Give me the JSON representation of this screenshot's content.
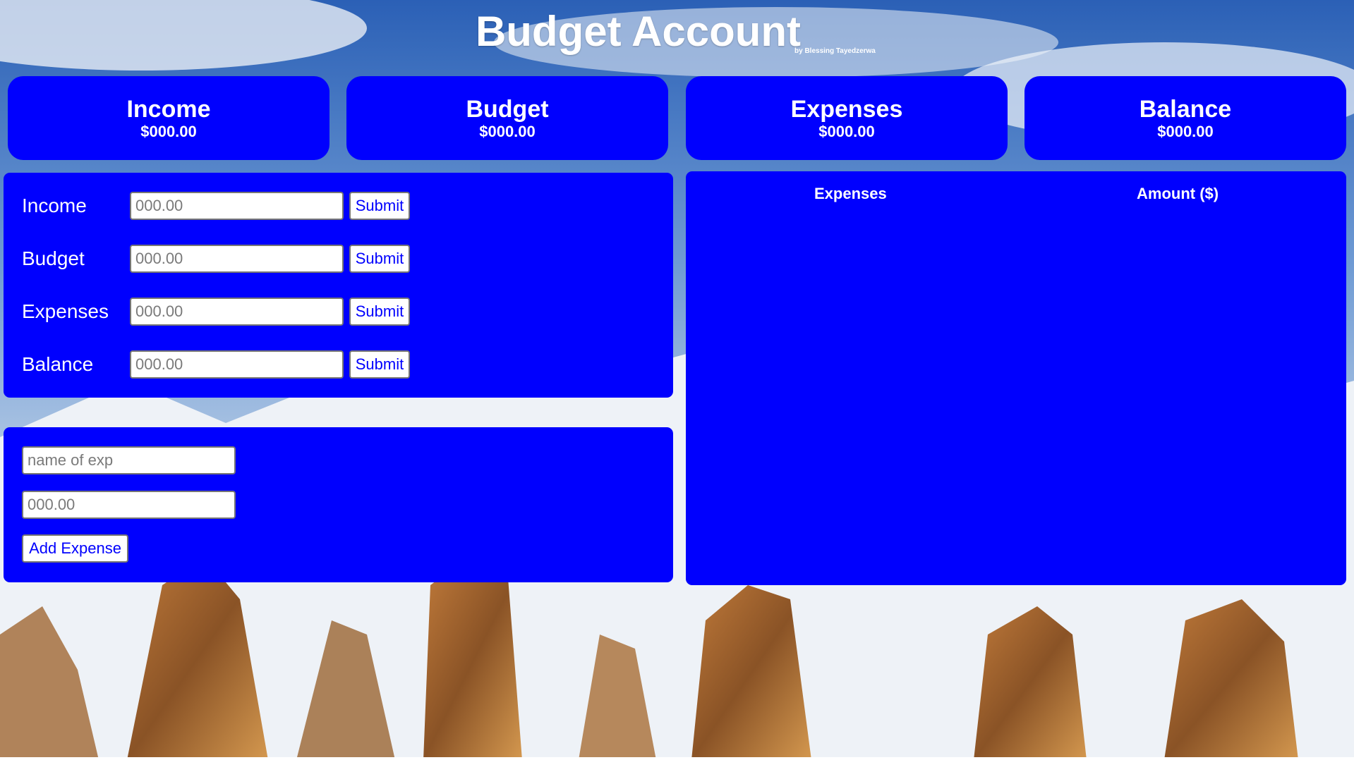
{
  "header": {
    "title": "Budget Account",
    "byline": "by Blessing Tayedzerwa"
  },
  "cards": [
    {
      "label": "Income",
      "value": "$000.00"
    },
    {
      "label": "Budget",
      "value": "$000.00"
    },
    {
      "label": "Expenses",
      "value": "$000.00"
    },
    {
      "label": "Balance",
      "value": "$000.00"
    }
  ],
  "form": {
    "rows": [
      {
        "label": "Income",
        "placeholder": "000.00",
        "value": "",
        "button": "Submit"
      },
      {
        "label": "Budget",
        "placeholder": "000.00",
        "value": "",
        "button": "Submit"
      },
      {
        "label": "Expenses",
        "placeholder": "000.00",
        "value": "",
        "button": "Submit"
      },
      {
        "label": "Balance",
        "placeholder": "000.00",
        "value": "",
        "button": "Submit"
      }
    ]
  },
  "add_expense": {
    "name_placeholder": "name of exp",
    "amount_placeholder": "000.00",
    "button": "Add Expense"
  },
  "table": {
    "headers": [
      "Expenses",
      "Amount ($)"
    ],
    "rows": []
  },
  "colors": {
    "panel": "#0000fe",
    "text": "#ffffff",
    "button_text": "#0000fe"
  }
}
